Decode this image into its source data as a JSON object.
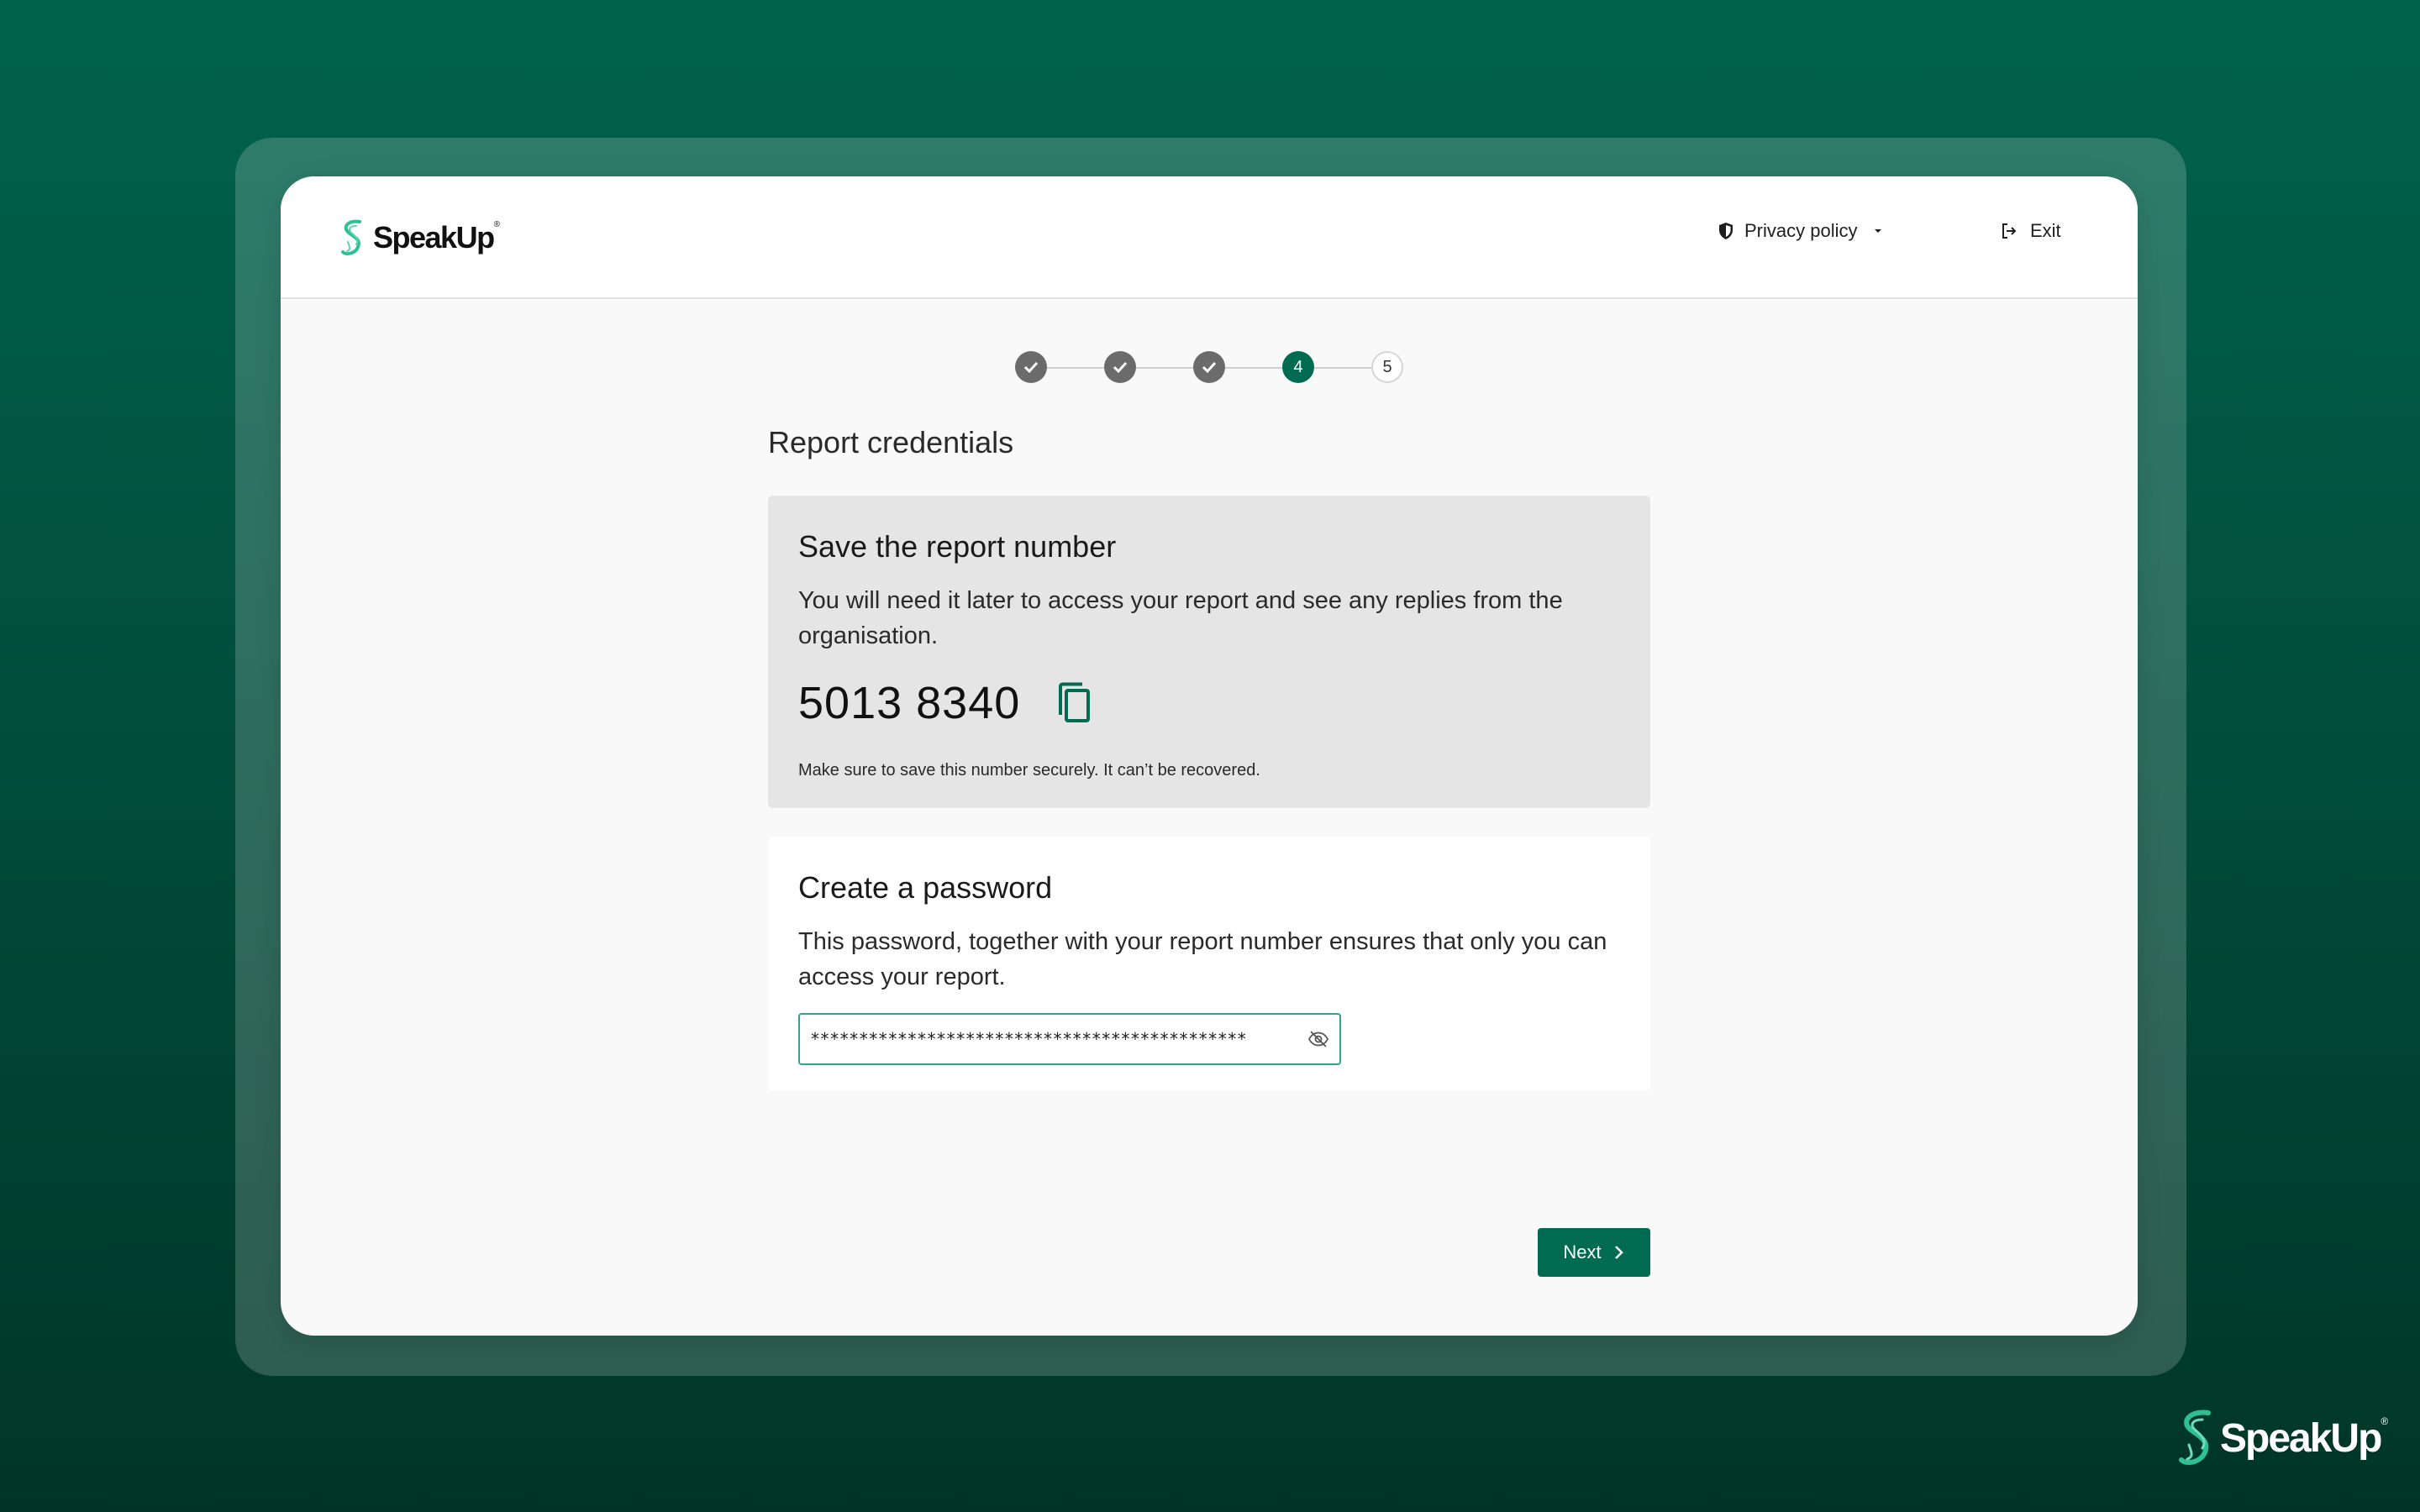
{
  "brand": {
    "name": "SpeakUp",
    "trademark": "®",
    "accent_color": "#006b50",
    "logo_color": "#2fbf94"
  },
  "header": {
    "privacy_label": "Privacy policy",
    "exit_label": "Exit"
  },
  "stepper": {
    "steps": [
      {
        "label": "",
        "state": "done"
      },
      {
        "label": "",
        "state": "done"
      },
      {
        "label": "",
        "state": "done"
      },
      {
        "label": "4",
        "state": "active"
      },
      {
        "label": "5",
        "state": "todo"
      }
    ]
  },
  "page": {
    "title": "Report credentials"
  },
  "report_number_card": {
    "title": "Save the report number",
    "description": "You will need it later to access your report and see any replies from the organisation.",
    "number": "5013 8340",
    "note": "Make sure to save this number securely. It can’t be recovered."
  },
  "password_card": {
    "title": "Create a password",
    "description": "This password, together with your report number ensures that only you can access your report.",
    "value": "*********************************************"
  },
  "actions": {
    "next_label": "Next"
  }
}
